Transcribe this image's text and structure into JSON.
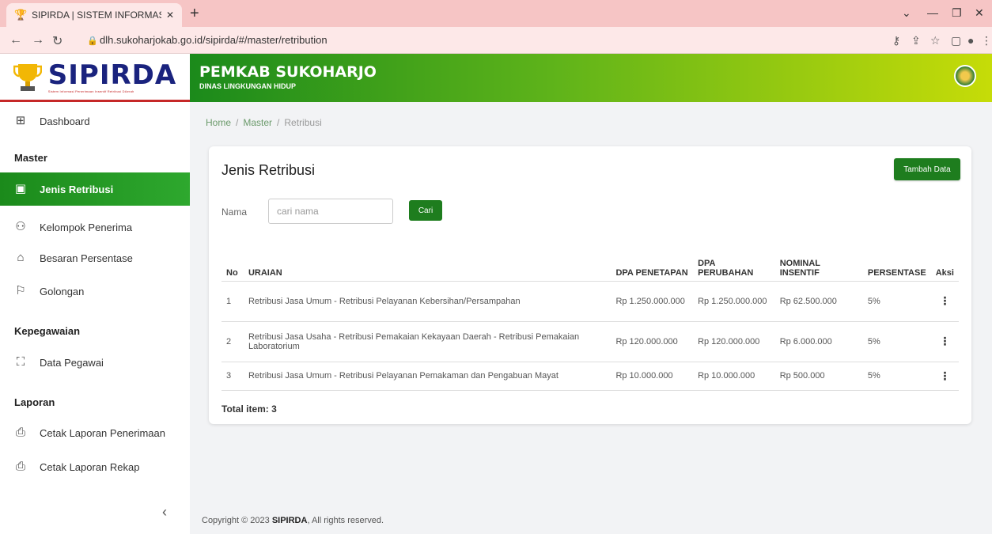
{
  "browser": {
    "tab_title": "SIPIRDA | SISTEM INFORMASI PE",
    "url": "dlh.sukoharjokab.go.id/sipirda/#/master/retribution"
  },
  "header": {
    "logo_text": "SIPIRDA",
    "logo_subtitle": "Sistem Informasi Penerimaan Insentif Retribusi DAerah",
    "org_title": "PEMKAB SUKOHARJO",
    "org_subtitle": "DINAS LINGKUNGAN HIDUP"
  },
  "sidebar": {
    "dashboard": "Dashboard",
    "master_heading": "Master",
    "jenis_retribusi": "Jenis Retribusi",
    "kelompok_penerima": "Kelompok Penerima",
    "besaran_persentase": "Besaran Persentase",
    "golongan": "Golongan",
    "kepegawaian_heading": "Kepegawaian",
    "data_pegawai": "Data Pegawai",
    "laporan_heading": "Laporan",
    "cetak_penerimaan": "Cetak Laporan Penerimaan",
    "cetak_rekap": "Cetak Laporan Rekap"
  },
  "breadcrumb": {
    "home": "Home",
    "master": "Master",
    "current": "Retribusi"
  },
  "card": {
    "title": "Jenis Retribusi",
    "add_button": "Tambah Data",
    "search_label": "Nama",
    "search_placeholder": "cari nama",
    "search_button": "Cari",
    "total": "Total item: 3"
  },
  "table": {
    "headers": {
      "no": "No",
      "uraian": "URAIAN",
      "dpa_penetapan": "DPA PENETAPAN",
      "dpa_perubahan": "DPA PERUBAHAN",
      "nominal_insentif": "NOMINAL INSENTIF",
      "persentase": "PERSENTASE",
      "aksi": "Aksi"
    },
    "rows": [
      {
        "no": "1",
        "uraian": "Retribusi Jasa Umum - Retribusi Pelayanan Kebersihan/Persampahan",
        "dpa_penetapan": "Rp 1.250.000.000",
        "dpa_perubahan": "Rp 1.250.000.000",
        "nominal_insentif": "Rp 62.500.000",
        "persentase": "5%"
      },
      {
        "no": "2",
        "uraian": "Retribusi Jasa Usaha - Retribusi Pemakaian Kekayaan Daerah - Retribusi Pemakaian Laboratorium",
        "dpa_penetapan": "Rp 120.000.000",
        "dpa_perubahan": "Rp 120.000.000",
        "nominal_insentif": "Rp 6.000.000",
        "persentase": "5%"
      },
      {
        "no": "3",
        "uraian": "Retribusi Jasa Umum - Retribusi Pelayanan Pemakaman dan Pengabuan Mayat",
        "dpa_penetapan": "Rp 10.000.000",
        "dpa_perubahan": "Rp 10.000.000",
        "nominal_insentif": "Rp 500.000",
        "persentase": "5%"
      }
    ]
  },
  "footer": {
    "prefix": "Copyright © 2023",
    "brand": "SIPIRDA",
    "suffix": ", All rights reserved."
  },
  "colors": {
    "primary_green": "#1e7d1e",
    "logo_blue": "#1a237e",
    "accent_red": "#c62828"
  }
}
